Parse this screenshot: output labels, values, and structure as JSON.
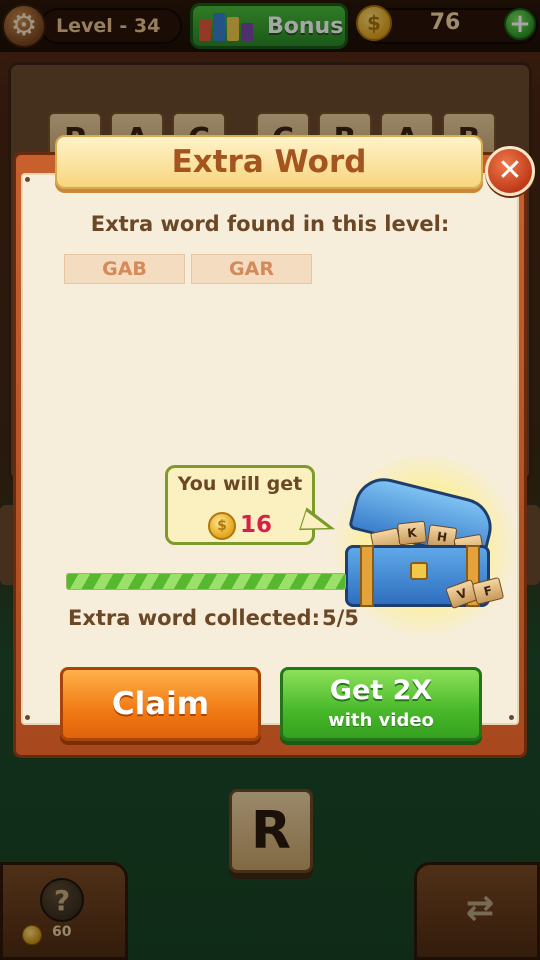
{
  "top_bar": {
    "level": "Level - 34",
    "bonus_label": "Bonus",
    "coins": "76",
    "settings_icon": "gear-icon",
    "add_icon": "plus-icon"
  },
  "board": {
    "row1": [
      "P",
      "A",
      "C"
    ],
    "row2": [
      "C",
      "R",
      "A",
      "B"
    ]
  },
  "bottom": {
    "current_letter": "R",
    "hint_cost": "60",
    "hint_icon": "lightbulb-question-icon",
    "shuffle_icon": "shuffle-icon"
  },
  "dialog": {
    "title": "Extra Word",
    "found_label": "Extra word found in this level:",
    "words": [
      "GAB",
      "GAR"
    ],
    "reward_label": "You will get",
    "reward_amount": "16",
    "progress_fraction": 1.0,
    "collected_label": "Extra word collected:",
    "collected_value": "5/5",
    "chest_tiles": [
      "K",
      "H",
      "V",
      "F"
    ],
    "claim_label": "Claim",
    "video_main": "Get  2X",
    "video_sub": "with video",
    "close_icon": "close-icon",
    "colors": {
      "title": "#a3541f",
      "claim": "#f07a14",
      "video": "#48b82a",
      "reward_amount": "#d6204a"
    }
  }
}
